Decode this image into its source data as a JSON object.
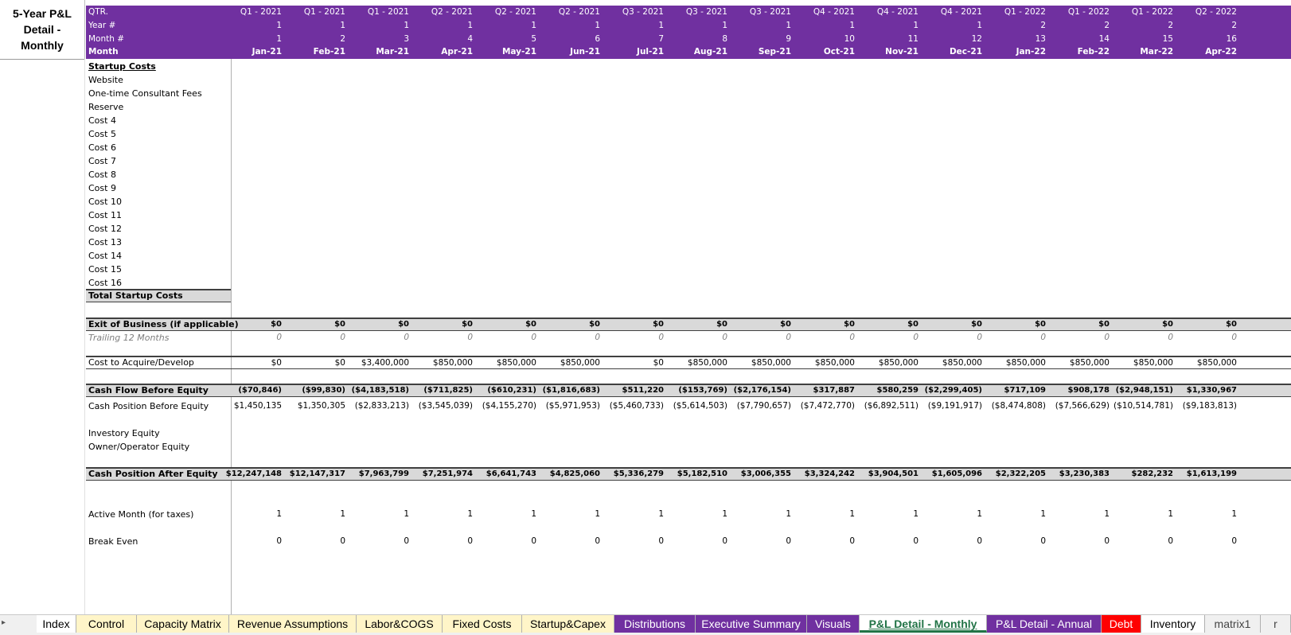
{
  "title": "5-Year P&L Detail - Monthly",
  "header_rows": [
    {
      "label": "QTR.",
      "values": [
        "Q1 - 2021",
        "Q1 - 2021",
        "Q1 - 2021",
        "Q2 - 2021",
        "Q2 - 2021",
        "Q2 - 2021",
        "Q3 - 2021",
        "Q3 - 2021",
        "Q3 - 2021",
        "Q4 - 2021",
        "Q4 - 2021",
        "Q4 - 2021",
        "Q1 - 2022",
        "Q1 - 2022",
        "Q1 - 2022",
        "Q2 - 2022"
      ]
    },
    {
      "label": "Year #",
      "values": [
        "1",
        "1",
        "1",
        "1",
        "1",
        "1",
        "1",
        "1",
        "1",
        "1",
        "1",
        "1",
        "2",
        "2",
        "2",
        "2"
      ]
    },
    {
      "label": "Month #",
      "values": [
        "1",
        "2",
        "3",
        "4",
        "5",
        "6",
        "7",
        "8",
        "9",
        "10",
        "11",
        "12",
        "13",
        "14",
        "15",
        "16"
      ]
    },
    {
      "label": "Month",
      "values": [
        "Jan-21",
        "Feb-21",
        "Mar-21",
        "Apr-21",
        "May-21",
        "Jun-21",
        "Jul-21",
        "Aug-21",
        "Sep-21",
        "Oct-21",
        "Nov-21",
        "Dec-21",
        "Jan-22",
        "Feb-22",
        "Mar-22",
        "Apr-22"
      ]
    }
  ],
  "startup": {
    "heading": "Startup Costs",
    "items": [
      "Website",
      "One-time Consultant Fees",
      "Reserve",
      "Cost 4",
      "Cost 5",
      "Cost 6",
      "Cost 7",
      "Cost 8",
      "Cost 9",
      "Cost 10",
      "Cost 11",
      "Cost 12",
      "Cost 13",
      "Cost 14",
      "Cost 15",
      "Cost 16"
    ],
    "total_label": "Total Startup Costs"
  },
  "exit_row": {
    "label": "Exit of Business (if applicable)",
    "values": [
      "$0",
      "$0",
      "$0",
      "$0",
      "$0",
      "$0",
      "$0",
      "$0",
      "$0",
      "$0",
      "$0",
      "$0",
      "$0",
      "$0",
      "$0",
      "$0"
    ]
  },
  "trailing_row": {
    "label": "Trailing 12 Months",
    "values": [
      "0",
      "0",
      "0",
      "0",
      "0",
      "0",
      "0",
      "0",
      "0",
      "0",
      "0",
      "0",
      "0",
      "0",
      "0",
      "0"
    ]
  },
  "acquire_row": {
    "label": "Cost to Acquire/Develop",
    "values": [
      "$0",
      "$0",
      "$3,400,000",
      "$850,000",
      "$850,000",
      "$850,000",
      "$0",
      "$850,000",
      "$850,000",
      "$850,000",
      "$850,000",
      "$850,000",
      "$850,000",
      "$850,000",
      "$850,000",
      "$850,000"
    ]
  },
  "cashflow_row": {
    "label": "Cash Flow Before Equity",
    "values": [
      "($70,846)",
      "($99,830)",
      "($4,183,518)",
      "($711,825)",
      "($610,231)",
      "($1,816,683)",
      "$511,220",
      "($153,769)",
      "($2,176,154)",
      "$317,887",
      "$580,259",
      "($2,299,405)",
      "$717,109",
      "$908,178",
      "($2,948,151)",
      "$1,330,967"
    ]
  },
  "position_row": {
    "label": "Cash Position Before Equity",
    "values": [
      "$1,450,135",
      "$1,350,305",
      "($2,833,213)",
      "($3,545,039)",
      "($4,155,270)",
      "($5,971,953)",
      "($5,460,733)",
      "($5,614,503)",
      "($7,790,657)",
      "($7,472,770)",
      "($6,892,511)",
      "($9,191,917)",
      "($8,474,808)",
      "($7,566,629)",
      "($10,514,781)",
      "($9,183,813)"
    ]
  },
  "equity_labels": [
    "Investory Equity",
    "Owner/Operator Equity"
  ],
  "after_row": {
    "label": "Cash Position After Equity",
    "values": [
      "$12,247,148",
      "$12,147,317",
      "$7,963,799",
      "$7,251,974",
      "$6,641,743",
      "$4,825,060",
      "$5,336,279",
      "$5,182,510",
      "$3,006,355",
      "$3,324,242",
      "$3,904,501",
      "$1,605,096",
      "$2,322,205",
      "$3,230,383",
      "$282,232",
      "$1,613,199"
    ]
  },
  "active_row": {
    "label": "Active Month (for taxes)",
    "values": [
      "1",
      "1",
      "1",
      "1",
      "1",
      "1",
      "1",
      "1",
      "1",
      "1",
      "1",
      "1",
      "1",
      "1",
      "1",
      "1"
    ]
  },
  "breakeven_row": {
    "label": "Break Even",
    "values": [
      "0",
      "0",
      "0",
      "0",
      "0",
      "0",
      "0",
      "0",
      "0",
      "0",
      "0",
      "0",
      "0",
      "0",
      "0",
      "0"
    ]
  },
  "tabs": [
    {
      "label": "Index",
      "style": "white"
    },
    {
      "label": "Control",
      "style": "yellow"
    },
    {
      "label": "Capacity Matrix",
      "style": "yellow"
    },
    {
      "label": "Revenue Assumptions",
      "style": "yellow"
    },
    {
      "label": "Labor&COGS",
      "style": "yellow"
    },
    {
      "label": "Fixed Costs",
      "style": "yellow"
    },
    {
      "label": "Startup&Capex",
      "style": "yellow"
    },
    {
      "label": "Distributions",
      "style": "purple"
    },
    {
      "label": "Executive Summary",
      "style": "purple"
    },
    {
      "label": "Visuals",
      "style": "purple"
    },
    {
      "label": "P&L Detail - Monthly",
      "style": "active"
    },
    {
      "label": "P&L Detail - Annual",
      "style": "purple"
    },
    {
      "label": "Debt",
      "style": "red"
    },
    {
      "label": "Inventory",
      "style": "white"
    },
    {
      "label": "matrix1",
      "style": "gray"
    },
    {
      "label": "r",
      "style": "gray"
    }
  ],
  "colors": {
    "header_purple": "#7030a0",
    "band_gray": "#d9d9d9",
    "tab_yellow": "#fff5c8",
    "debt_red": "#ff0000",
    "active_green": "#217346"
  }
}
